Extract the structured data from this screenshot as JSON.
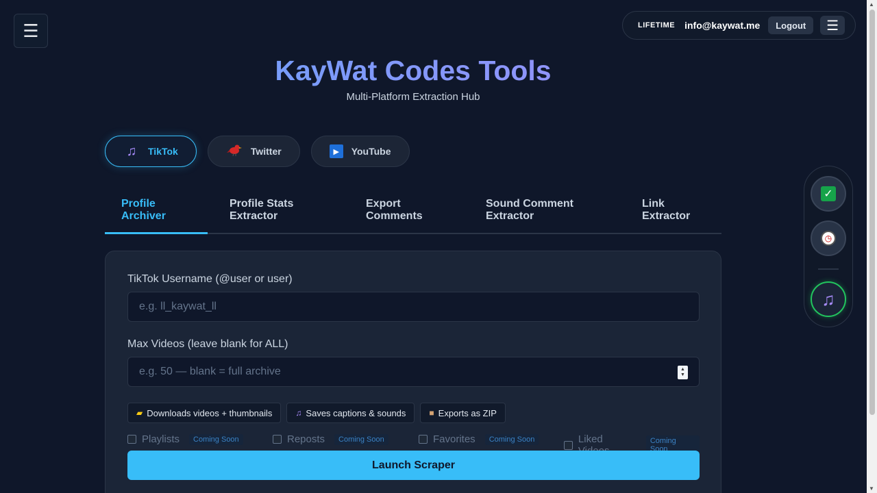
{
  "menu_icon": "hamburger-icon",
  "header": {
    "plan_badge": "LIFETIME",
    "email": "info@kaywat.me",
    "logout_label": "Logout"
  },
  "title": "KayWat Codes Tools",
  "subtitle": "Multi-Platform Extraction Hub",
  "platform_tabs": [
    {
      "label": "TikTok",
      "icon": "music-note-icon",
      "active": true
    },
    {
      "label": "Twitter",
      "icon": "bird-icon",
      "active": false
    },
    {
      "label": "YouTube",
      "icon": "play-icon",
      "active": false
    }
  ],
  "tool_tabs": [
    {
      "label_line1": "Profile",
      "label_line2": "Archiver",
      "active": true
    },
    {
      "label_line1": "Profile Stats",
      "label_line2": "Extractor",
      "active": false
    },
    {
      "label_line1": "Export",
      "label_line2": "Comments",
      "active": false
    },
    {
      "label_line1": "Sound Comment",
      "label_line2": "Extractor",
      "active": false
    },
    {
      "label_line1": "Link",
      "label_line2": "Extractor",
      "active": false
    }
  ],
  "form": {
    "username_label": "TikTok Username (@user or user)",
    "username_placeholder": "e.g. ll_kaywat_ll",
    "max_label": "Max Videos (leave blank for ALL)",
    "max_placeholder": "e.g. 50 — blank = full archive",
    "chips": [
      {
        "icon": "folder-icon",
        "label": "Downloads videos + thumbnails"
      },
      {
        "icon": "music-note-icon",
        "label": "Saves captions & sounds"
      },
      {
        "icon": "package-icon",
        "label": "Exports as ZIP"
      }
    ],
    "options": [
      {
        "label": "Playlists",
        "badge": "Coming Soon"
      },
      {
        "label": "Reposts",
        "badge": "Coming Soon"
      },
      {
        "label": "Favorites",
        "badge": "Coming Soon"
      },
      {
        "label": "Liked Videos",
        "badge": "Coming Soon"
      }
    ],
    "launch_label": "Launch Scraper"
  },
  "rail": {
    "icons": [
      "checkmark-icon",
      "clock-icon",
      "music-note-icon"
    ]
  },
  "colors": {
    "background": "#0f172a",
    "accent": "#38bdf8",
    "rail_active": "#22c55e"
  }
}
